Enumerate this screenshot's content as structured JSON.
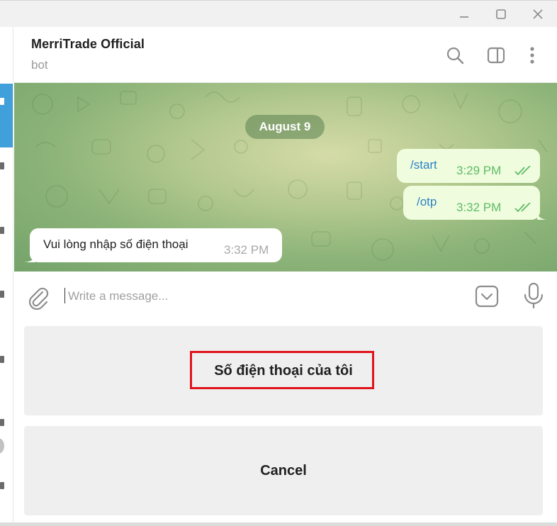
{
  "window": {
    "controls": [
      {
        "name": "minimize-button",
        "icon": "minimize-icon"
      },
      {
        "name": "maximize-button",
        "icon": "maximize-icon"
      },
      {
        "name": "close-button",
        "icon": "close-icon"
      }
    ]
  },
  "chat": {
    "title": "MerriTrade Official",
    "subtitle": "bot",
    "header_icons": [
      "search-icon",
      "sidebar-toggle-icon",
      "more-vertical-icon"
    ]
  },
  "messages": {
    "date": "August 9",
    "outgoing": [
      {
        "text": "/start",
        "time": "3:29 PM",
        "status": "read-double-check"
      },
      {
        "text": "/otp",
        "time": "3:32 PM",
        "status": "read-double-check"
      }
    ],
    "incoming": [
      {
        "text": "Vui lòng nhập số điện thoại",
        "time": "3:32 PM"
      }
    ]
  },
  "composer": {
    "placeholder": "Write a message...",
    "icons": [
      "paperclip-icon",
      "keyboard-toggle-icon",
      "microphone-icon"
    ]
  },
  "keyboard": {
    "buttons": [
      {
        "label": "Số điện thoại của tôi",
        "highlighted": true
      },
      {
        "label": "Cancel",
        "highlighted": false
      }
    ]
  },
  "colors": {
    "accent": "#419fd9",
    "outgoing_bubble": "#effdde",
    "command_text": "#2d80c4",
    "read_check": "#5fba67",
    "highlight": "#e0141c",
    "keyboard_button": "#efefef"
  }
}
